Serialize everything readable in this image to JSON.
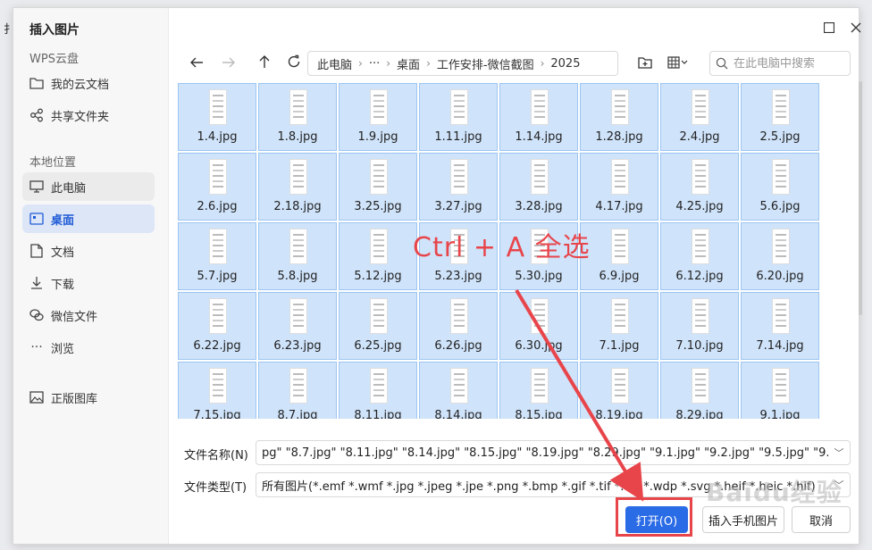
{
  "dialog": {
    "title": "插入图片",
    "window_buttons": [
      "maximize-icon",
      "close-icon"
    ]
  },
  "sidebar": {
    "cloud_section": "WPS云盘",
    "cloud_items": [
      {
        "label": "我的云文档",
        "icon": "folder-icon"
      },
      {
        "label": "共享文件夹",
        "icon": "share-icon"
      }
    ],
    "local_section": "本地位置",
    "local_items": [
      {
        "label": "此电脑",
        "icon": "monitor-icon"
      },
      {
        "label": "桌面",
        "icon": "desktop-icon"
      },
      {
        "label": "文档",
        "icon": "document-icon"
      },
      {
        "label": "下载",
        "icon": "download-icon"
      },
      {
        "label": "微信文件",
        "icon": "wechat-icon"
      },
      {
        "label": "浏览",
        "icon": "more-icon"
      }
    ],
    "gallery_item": {
      "label": "正版图库",
      "icon": "image-icon"
    }
  },
  "toolbar": {
    "breadcrumb": [
      "此电脑",
      "···",
      "桌面",
      "工作安排-微信截图",
      "2025"
    ],
    "search_placeholder": "在此电脑中搜索"
  },
  "files": [
    "1.4.jpg",
    "1.8.jpg",
    "1.9.jpg",
    "1.11.jpg",
    "1.14.jpg",
    "1.28.jpg",
    "2.4.jpg",
    "2.5.jpg",
    "2.6.jpg",
    "2.18.jpg",
    "3.25.jpg",
    "3.27.jpg",
    "3.28.jpg",
    "4.17.jpg",
    "4.25.jpg",
    "5.6.jpg",
    "5.7.jpg",
    "5.8.jpg",
    "5.12.jpg",
    "5.23.jpg",
    "5.30.jpg",
    "6.9.jpg",
    "6.12.jpg",
    "6.20.jpg",
    "6.22.jpg",
    "6.23.jpg",
    "6.25.jpg",
    "6.26.jpg",
    "6.30.jpg",
    "7.1.jpg",
    "7.10.jpg",
    "7.14.jpg",
    "7.15.jpg",
    "8.7.jpg",
    "8.11.jpg",
    "8.14.jpg",
    "8.15.jpg",
    "8.19.jpg",
    "8.29.jpg",
    "9.1.jpg"
  ],
  "filename_field": {
    "label": "文件名称(N)",
    "value": "pg\" \"8.7.jpg\" \"8.11.jpg\" \"8.14.jpg\" \"8.15.jpg\" \"8.19.jpg\" \"8.29.jpg\" \"9.1.jpg\" \"9.2.jpg\" \"9.5.jpg\" \"9.9.jpg\""
  },
  "filetype_field": {
    "label": "文件类型(T)",
    "value": "所有图片(*.emf *.wmf *.jpg *.jpeg *.jpe *.png *.bmp *.gif *.tif *.tiff *.wdp *.svg *.heif *.heic *.hif)"
  },
  "buttons": {
    "open": "打开(O)",
    "insert_phone": "插入手机图片",
    "cancel": "取消"
  },
  "annotation": {
    "text": "Ctrl + A  全选",
    "color": "#e8454b"
  },
  "watermark": "Baidu经验",
  "stray_text": "扌"
}
